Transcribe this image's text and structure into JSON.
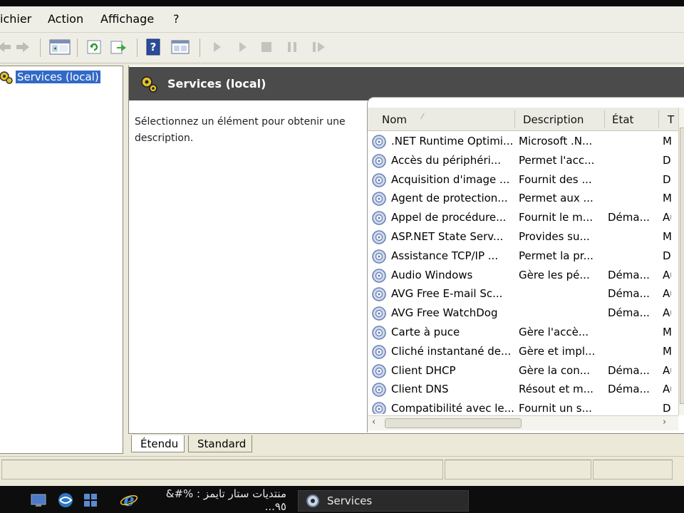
{
  "menu": {
    "items": [
      "ichier",
      "Action",
      "Affichage",
      "?"
    ]
  },
  "toolbar": {
    "icons": [
      "back-arrow-icon",
      "forward-arrow-icon",
      "show-hide-console-tree-icon",
      "refresh-icon",
      "export-list-icon",
      "help-icon",
      "properties-icon",
      "start-service-icon",
      "start-service-alt-icon",
      "stop-service-icon",
      "pause-service-icon",
      "restart-service-icon"
    ]
  },
  "tree": {
    "root_label": "Services (local)"
  },
  "pane": {
    "title": "Services (local)",
    "description": "Sélectionnez un élément pour obtenir une description."
  },
  "list": {
    "columns": {
      "name": "Nom",
      "description": "Description",
      "state": "État",
      "type": "T"
    },
    "rows": [
      {
        "name": ".NET Runtime Optimi...",
        "description": "Microsoft .N...",
        "state": "",
        "type": "Ma"
      },
      {
        "name": "Accès du périphéri...",
        "description": "Permet l'acc...",
        "state": "",
        "type": "Dé"
      },
      {
        "name": "Acquisition d'image ...",
        "description": "Fournit des ...",
        "state": "",
        "type": "Dé"
      },
      {
        "name": "Agent de protection...",
        "description": "Permet aux ...",
        "state": "",
        "type": "Ma"
      },
      {
        "name": "Appel de procédure...",
        "description": "Fournit le m...",
        "state": "Déma...",
        "type": "Au"
      },
      {
        "name": "ASP.NET State Serv...",
        "description": "Provides su...",
        "state": "",
        "type": "Ma"
      },
      {
        "name": "Assistance TCP/IP ...",
        "description": "Permet la pr...",
        "state": "",
        "type": "Dé"
      },
      {
        "name": "Audio Windows",
        "description": "Gère les pé...",
        "state": "Déma...",
        "type": "Au"
      },
      {
        "name": "AVG Free E-mail Sc...",
        "description": "",
        "state": "Déma...",
        "type": "Au"
      },
      {
        "name": "AVG Free WatchDog",
        "description": "",
        "state": "Déma...",
        "type": "Au"
      },
      {
        "name": "Carte à puce",
        "description": "Gère l'accè...",
        "state": "",
        "type": "Ma"
      },
      {
        "name": "Cliché instantané de...",
        "description": "Gère et impl...",
        "state": "",
        "type": "Ma"
      },
      {
        "name": "Client DHCP",
        "description": "Gère la con...",
        "state": "Déma...",
        "type": "Au"
      },
      {
        "name": "Client DNS",
        "description": "Résout et m...",
        "state": "Déma...",
        "type": "Au"
      },
      {
        "name": "Compatibilité avec le...",
        "description": "Fournit un s...",
        "state": "",
        "type": "Dé"
      }
    ]
  },
  "tabs": {
    "extended": "Étendu",
    "standard": "Standard"
  },
  "taskbar": {
    "ie_window_label": "منتديات ستار تايمز : %#& ٩٥...",
    "services_window_label": "Services"
  },
  "colors": {
    "selection": "#3169c6",
    "header_dark": "#4b4b4b",
    "chrome": "#ece9d8",
    "taskbar": "#0d0d0d"
  }
}
